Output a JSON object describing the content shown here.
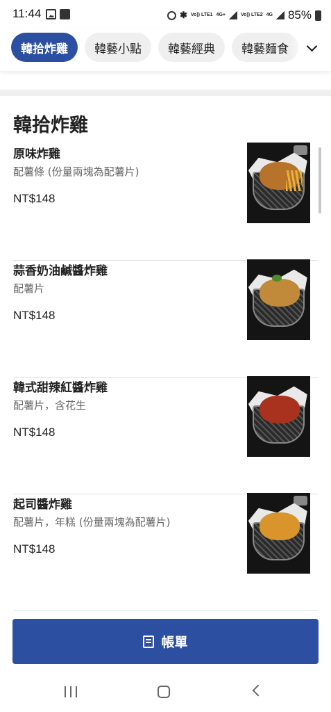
{
  "status_bar": {
    "time": "11:44",
    "carrier1": "Vo)) LTE1",
    "net1": "4G+",
    "carrier2": "Vo)) LTE2",
    "net2": "4G",
    "battery": "85%"
  },
  "categories": [
    {
      "label": "韓拾炸雞",
      "active": true
    },
    {
      "label": "韓藝小點",
      "active": false
    },
    {
      "label": "韓藝經典",
      "active": false
    },
    {
      "label": "韓藝麵食",
      "active": false
    }
  ],
  "section": {
    "title": "韓拾炸雞"
  },
  "items": [
    {
      "name": "原味炸雞",
      "desc": "配薯條 (份量兩塊為配薯片)",
      "price": "NT$148",
      "chicken_color": "#b8732a"
    },
    {
      "name": "蒜香奶油鹹醬炸雞",
      "desc": "配薯片",
      "price": "NT$148",
      "chicken_color": "#c08a3a"
    },
    {
      "name": "韓式甜辣紅醬炸雞",
      "desc": "配薯片，含花生",
      "price": "NT$148",
      "chicken_color": "#a8321e"
    },
    {
      "name": "起司醬炸雞",
      "desc": "配薯片，年糕 (份量兩塊為配薯片)",
      "price": "NT$148",
      "chicken_color": "#d9952c"
    }
  ],
  "bill_button": {
    "label": "帳單"
  },
  "colors": {
    "accent": "#2c4fa1"
  },
  "icons": [
    "alarm-icon",
    "bluetooth-icon",
    "signal-icon",
    "battery-icon",
    "receipt-icon",
    "chevron-down-icon",
    "nav-recent-icon",
    "nav-home-icon",
    "nav-back-icon"
  ]
}
